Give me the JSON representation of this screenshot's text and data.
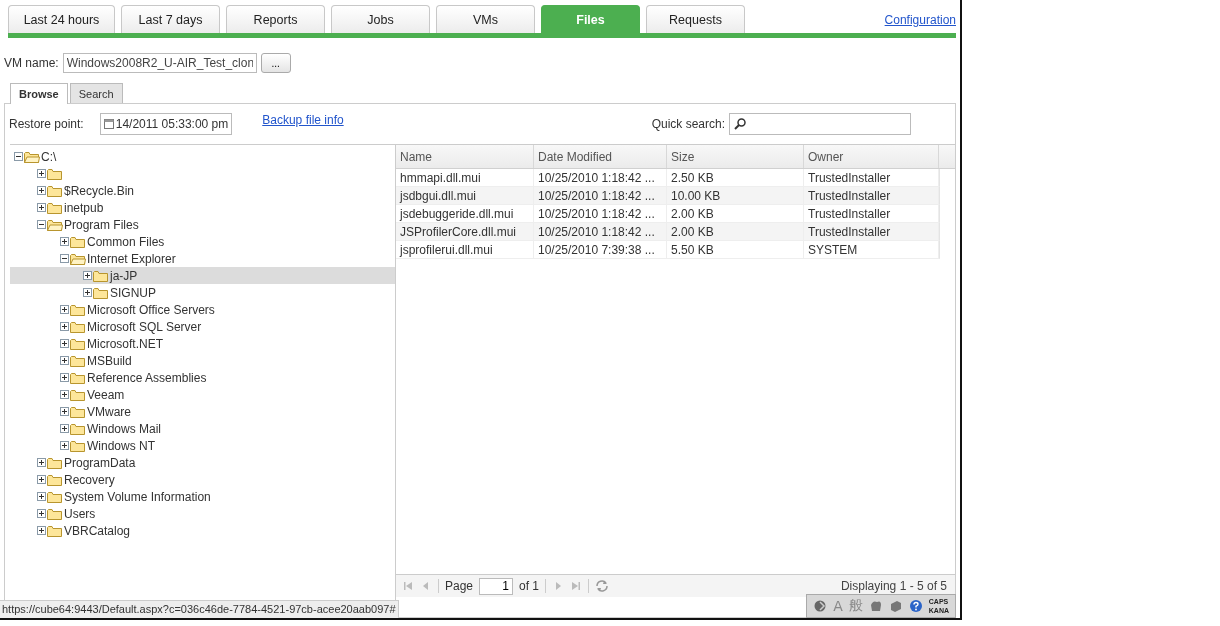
{
  "tabs": [
    {
      "label": "Last 24 hours",
      "selected": false
    },
    {
      "label": "Last 7 days",
      "selected": false
    },
    {
      "label": "Reports",
      "selected": false
    },
    {
      "label": "Jobs",
      "selected": false
    },
    {
      "label": "VMs",
      "selected": false
    },
    {
      "label": "Files",
      "selected": true
    },
    {
      "label": "Requests",
      "selected": false
    }
  ],
  "configuration_link": "Configuration",
  "vm_name": {
    "label": "VM name:",
    "value": "Windows2008R2_U-AIR_Test_clon",
    "browse_button": "..."
  },
  "subtabs": [
    {
      "label": "Browse",
      "selected": true
    },
    {
      "label": "Search",
      "selected": false
    }
  ],
  "restore_point": {
    "label": "Restore point:",
    "value": "14/2011 05:33:00 pm"
  },
  "backup_file_info_link": "Backup file info",
  "quick_search": {
    "label": "Quick search:"
  },
  "tree": [
    {
      "label": "C:\\",
      "expanded": true,
      "selected": false,
      "children": [
        {
          "expanded": false,
          "selected": false
        },
        {
          "label": "$Recycle.Bin",
          "expanded": false,
          "selected": false
        },
        {
          "label": "inetpub",
          "expanded": false,
          "selected": false
        },
        {
          "label": "Program Files",
          "expanded": true,
          "selected": false,
          "children": [
            {
              "label": "Common Files",
              "expanded": false,
              "selected": false
            },
            {
              "label": "Internet Explorer",
              "expanded": true,
              "selected": false,
              "children": [
                {
                  "label": "ja-JP",
                  "expanded": false,
                  "selected": true
                },
                {
                  "label": "SIGNUP",
                  "expanded": false,
                  "selected": false
                }
              ]
            },
            {
              "label": "Microsoft Office Servers",
              "expanded": false,
              "selected": false
            },
            {
              "label": "Microsoft SQL Server",
              "expanded": false,
              "selected": false
            },
            {
              "label": "Microsoft.NET",
              "expanded": false,
              "selected": false
            },
            {
              "label": "MSBuild",
              "expanded": false,
              "selected": false
            },
            {
              "label": "Reference Assemblies",
              "expanded": false,
              "selected": false
            },
            {
              "label": "Veeam",
              "expanded": false,
              "selected": false
            },
            {
              "label": "VMware",
              "expanded": false,
              "selected": false
            },
            {
              "label": "Windows Mail",
              "expanded": false,
              "selected": false
            },
            {
              "label": "Windows NT",
              "expanded": false,
              "selected": false
            }
          ]
        },
        {
          "label": "ProgramData",
          "expanded": false,
          "selected": false
        },
        {
          "label": "Recovery",
          "expanded": false,
          "selected": false
        },
        {
          "label": "System Volume Information",
          "expanded": false,
          "selected": false
        },
        {
          "label": "Users",
          "expanded": false,
          "selected": false
        },
        {
          "label": "VBRCatalog",
          "expanded": false,
          "selected": false
        }
      ]
    }
  ],
  "table": {
    "columns": [
      "Name",
      "Date Modified",
      "Size",
      "Owner"
    ],
    "rows": [
      [
        "hmmapi.dll.mui",
        "10/25/2010 1:18:42 ...",
        "2.50 KB",
        "TrustedInstaller"
      ],
      [
        "jsdbgui.dll.mui",
        "10/25/2010 1:18:42 ...",
        "10.00 KB",
        "TrustedInstaller"
      ],
      [
        "jsdebuggeride.dll.mui",
        "10/25/2010 1:18:42 ...",
        "2.00 KB",
        "TrustedInstaller"
      ],
      [
        "JSProfilerCore.dll.mui",
        "10/25/2010 1:18:42 ...",
        "2.00 KB",
        "TrustedInstaller"
      ],
      [
        "jsprofilerui.dll.mui",
        "10/25/2010 7:39:38 ...",
        "5.50 KB",
        "SYSTEM"
      ]
    ]
  },
  "pager": {
    "page_label": "Page",
    "page": "1",
    "of": "of 1",
    "displaying": "Displaying 1 - 5 of 5"
  },
  "status_url": "https://cube64:9443/Default.aspx?c=036c46de-7784-4521-97cb-acee20aab097#",
  "ime": {
    "mode": "A",
    "char": "般",
    "caps": "CAPS",
    "kana": "KANA"
  }
}
